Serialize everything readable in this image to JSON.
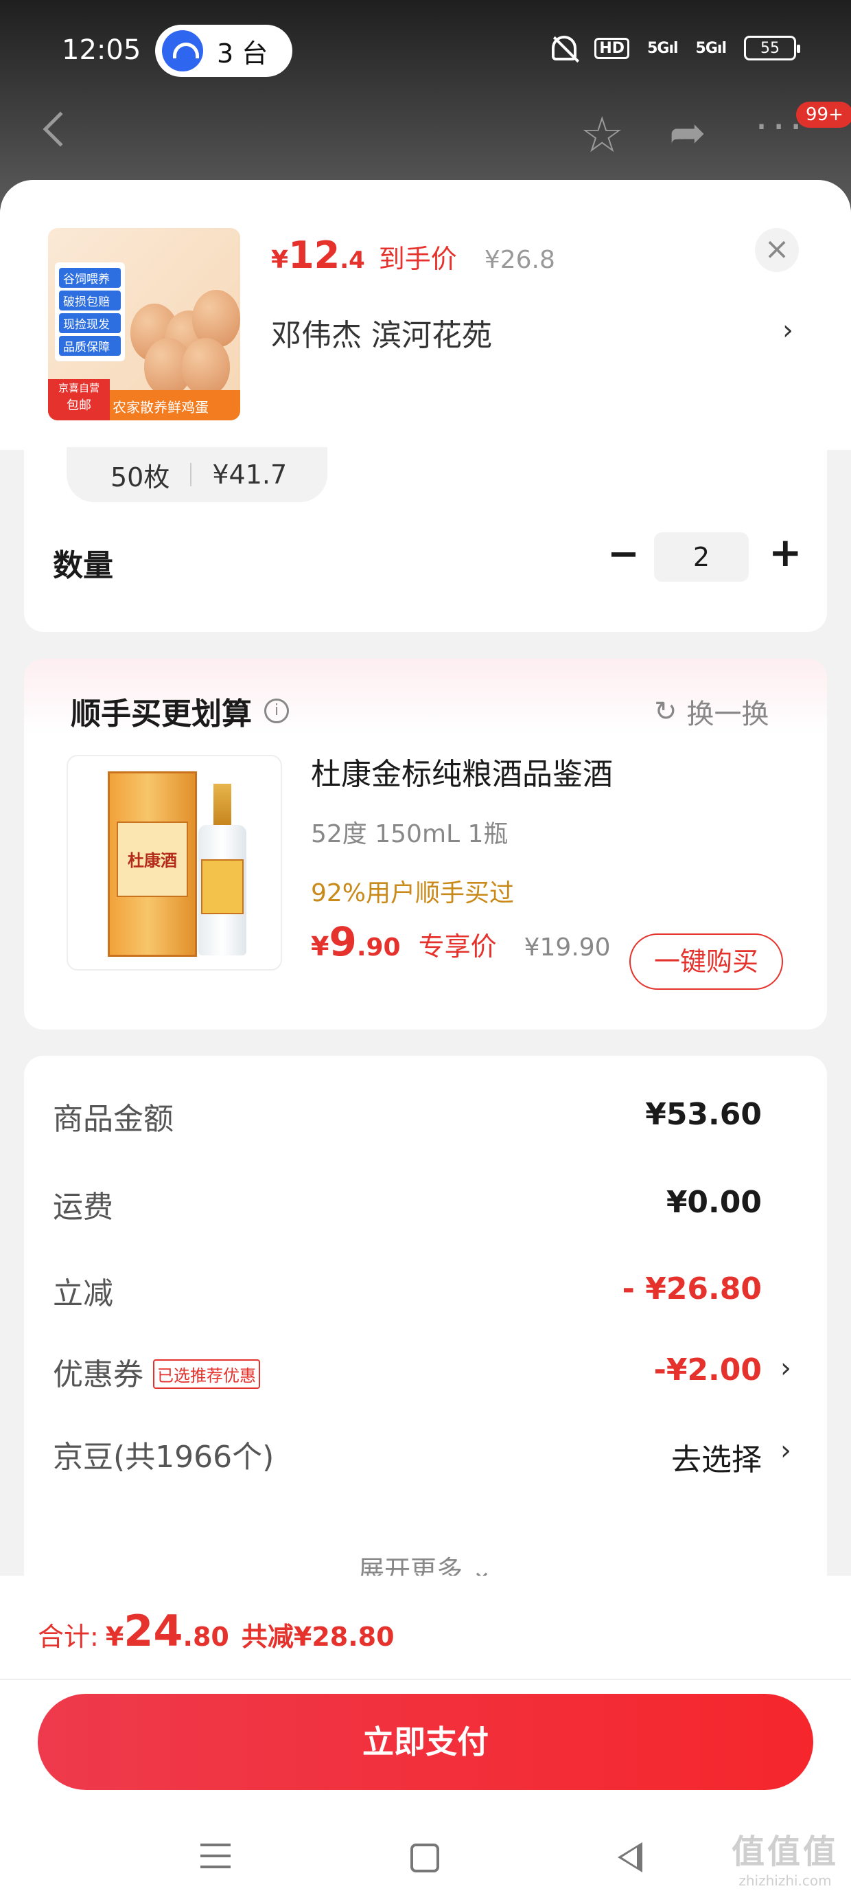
{
  "status_bar": {
    "time": "12:05",
    "hotspot_label": "3 台",
    "hd": "HD",
    "signal1": "5G",
    "signal2": "5G",
    "battery": "55"
  },
  "nav": {
    "badge": "99+"
  },
  "product": {
    "price_yen": "¥",
    "price_int": "12",
    "price_dec": ".4",
    "price_label": "到手价",
    "original_price": "¥26.8",
    "address": "邓伟杰  滨河花苑",
    "image_tags": [
      "谷饲喂养",
      "破损包赔",
      "现捡现发",
      "品质保障"
    ],
    "image_self_tag_1": "京喜自营",
    "image_self_tag_2": "包邮",
    "image_banner": "农家散养鲜鸡蛋"
  },
  "spec": {
    "name": "50枚",
    "price": "¥41.7"
  },
  "quantity": {
    "label": "数量",
    "minus": "−",
    "value": "2",
    "plus": "+"
  },
  "addon": {
    "title": "顺手买更划算",
    "info": "i",
    "swap_label": "换一换",
    "name": "杜康金标纯粮酒品鉴酒",
    "spec": "52度 150mL 1瓶",
    "rate": "92%用户顺手买过",
    "price_yen": "¥",
    "price_int": "9",
    "price_dec": ".90",
    "price_label": "专享价",
    "original_price": "¥19.90",
    "buy_label": "一键购买",
    "box_text": "杜康酒"
  },
  "summary": {
    "rows": [
      {
        "label": "商品金额",
        "value": "¥53.60"
      },
      {
        "label": "运费",
        "value": "¥0.00"
      },
      {
        "label": "立减",
        "value": "- ¥26.80"
      },
      {
        "label": "优惠券",
        "tag": "已选推荐优惠",
        "value": "-¥2.00"
      },
      {
        "label": "京豆(共1966个)",
        "value": "去选择"
      }
    ],
    "expand_label": "展开更多 ⌄"
  },
  "footer": {
    "total_label": "合计:",
    "total_yen": "¥",
    "total_int": "24",
    "total_dec": ".80",
    "discount": "共减¥28.80",
    "pay_label": "立即支付"
  },
  "watermark": {
    "logo": "值值值",
    "url": "zhizhizhi.com"
  },
  "colors": {
    "accent": "#e5322c",
    "rate": "#c98a1a",
    "pay_gradient_start": "#ee3a4c",
    "pay_gradient_end": "#f5262c"
  },
  "icons": [
    "back-icon",
    "star-icon",
    "share-icon",
    "more-icon",
    "close-icon",
    "chevron-right-icon",
    "info-icon",
    "refresh-icon",
    "menu-icon",
    "home-icon",
    "back-gesture-icon"
  ]
}
